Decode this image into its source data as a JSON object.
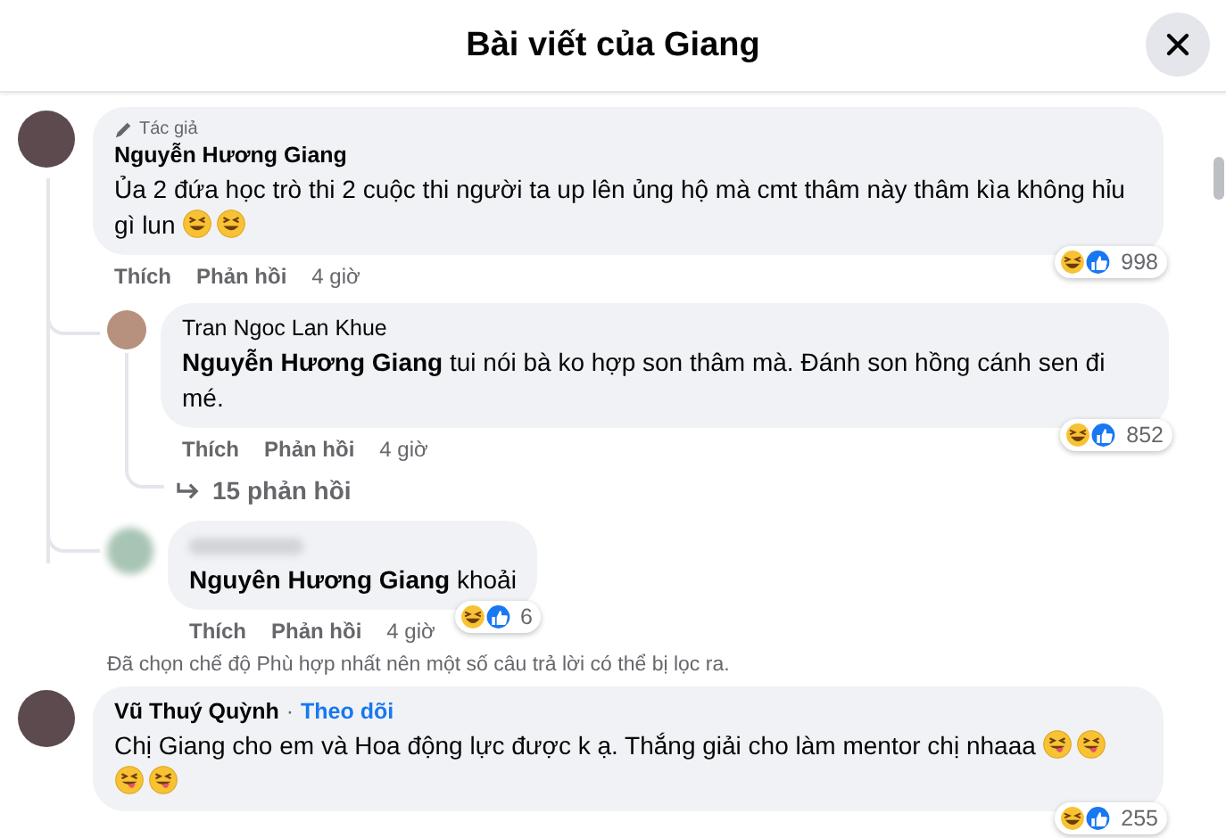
{
  "header": {
    "title": "Bài viết của Giang"
  },
  "feed": [
    {
      "kind": "comment",
      "author": "Nguyễn Hương Giang",
      "badge": "Tác giả",
      "body": [
        {
          "kind": "text",
          "text": "Ủa 2 đứa học trò thi 2 cuộc thi người ta up lên ủng hộ mà cmt thâm này thâm kìa không hỉu gì lun "
        },
        {
          "kind": "laugh-emoji"
        },
        {
          "kind": "laugh-emoji"
        }
      ],
      "actions": [
        "Thích",
        "Phản hồi"
      ],
      "time": "4 giờ",
      "reaction_count": "998",
      "replies": [
        {
          "kind": "named",
          "author": "Tran Ngoc Lan Khue",
          "body": [
            {
              "kind": "mention",
              "text": "Nguyễn Hương Giang"
            },
            {
              "kind": "text",
              "text": " tui nói bà ko hợp son thâm mà. Đánh son hồng cánh sen đi mé."
            }
          ],
          "actions": [
            "Thích",
            "Phản hồi"
          ],
          "time": "4 giờ",
          "reaction_count": "852",
          "more_replies": "15 phản hồi"
        },
        {
          "kind": "blurred",
          "body": [
            {
              "kind": "mention",
              "text": "Nguyên Hương Giang"
            },
            {
              "kind": "text",
              "text": " khoải"
            }
          ],
          "actions": [
            "Thích",
            "Phản hồi"
          ],
          "time": "4 giờ",
          "reaction_count": "6"
        }
      ]
    },
    {
      "kind": "notice",
      "text": "Đã chọn chế độ Phù hợp nhất nên một số câu trả lời có thể bị lọc ra."
    },
    {
      "kind": "comment",
      "author": "Vũ Thuý Quỳnh",
      "follow": {
        "separator": "·",
        "label": "Theo dõi"
      },
      "body": [
        {
          "kind": "text",
          "text": "Chị Giang cho em và Hoa động lực được k ạ. Thắng giải cho làm mentor chị nhaaa "
        },
        {
          "kind": "tongue-emoji"
        },
        {
          "kind": "tongue-emoji"
        },
        {
          "kind": "tongue-emoji"
        },
        {
          "kind": "tongue-emoji"
        }
      ],
      "reaction_count": "255"
    }
  ]
}
